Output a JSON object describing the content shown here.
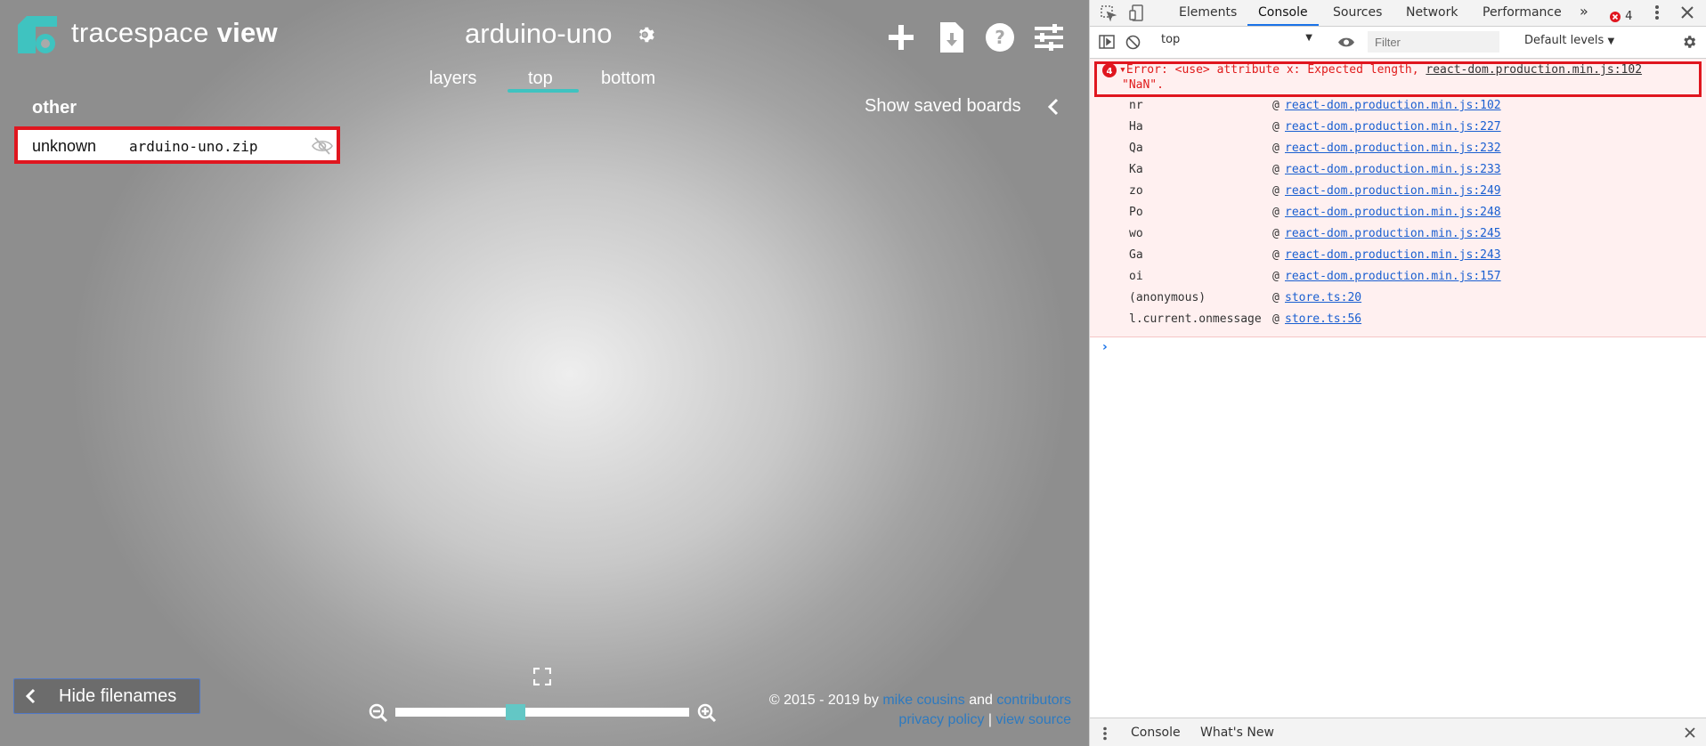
{
  "app": {
    "brand": {
      "name_light": "tracespace",
      "name_bold": "view"
    },
    "board_title": "arduino-uno",
    "tabs": [
      {
        "label": "layers"
      },
      {
        "label": "top"
      },
      {
        "label": "bottom"
      }
    ],
    "active_tab": "top",
    "layer_group": {
      "title": "other"
    },
    "layer": {
      "type": "unknown",
      "filename": "arduino-uno.zip"
    },
    "saved_boards_label": "Show saved boards",
    "hide_filenames_label": "Hide filenames",
    "zoom_level": 0.41,
    "footer": {
      "copyright": "© 2015 - 2019 by",
      "author": "mike cousins",
      "and": "and",
      "contributors": "contributors",
      "privacy": "privacy policy",
      "separator": "|",
      "source": "view source"
    },
    "colors": {
      "accent": "#3fc3c0",
      "highlight": "#e0161f"
    },
    "icons": {
      "logo": "tracespace-logo",
      "settings": "gear-icon",
      "add": "plus-icon",
      "download": "download-file-icon",
      "help": "help-circle-icon",
      "preferences": "sliders-icon"
    }
  },
  "devtools": {
    "tabs": [
      {
        "label": "Elements"
      },
      {
        "label": "Console"
      },
      {
        "label": "Sources"
      },
      {
        "label": "Network"
      },
      {
        "label": "Performance"
      }
    ],
    "more_tabs": "»",
    "error_count": "4",
    "context": "top",
    "filter_placeholder": "Filter",
    "levels": "Default levels",
    "error": {
      "count_badge": "4",
      "message": "Error: <use> attribute x: Expected length,",
      "message_cont": "\"NaN\".",
      "source": "react-dom.production.min.js:102"
    },
    "stack": [
      {
        "fn": "nr",
        "src": "react-dom.production.min.js:102"
      },
      {
        "fn": "Ha",
        "src": "react-dom.production.min.js:227"
      },
      {
        "fn": "Qa",
        "src": "react-dom.production.min.js:232"
      },
      {
        "fn": "Ka",
        "src": "react-dom.production.min.js:233"
      },
      {
        "fn": "zo",
        "src": "react-dom.production.min.js:249"
      },
      {
        "fn": "Po",
        "src": "react-dom.production.min.js:248"
      },
      {
        "fn": "wo",
        "src": "react-dom.production.min.js:245"
      },
      {
        "fn": "Ga",
        "src": "react-dom.production.min.js:243"
      },
      {
        "fn": "oi",
        "src": "react-dom.production.min.js:157"
      },
      {
        "fn": "(anonymous)",
        "src": "store.ts:20"
      },
      {
        "fn": "l.current.onmessage",
        "src": "store.ts:56"
      }
    ],
    "at_symbol": "@",
    "prompt": "›",
    "drawer_tabs": [
      {
        "label": "Console"
      },
      {
        "label": "What's New"
      }
    ]
  }
}
